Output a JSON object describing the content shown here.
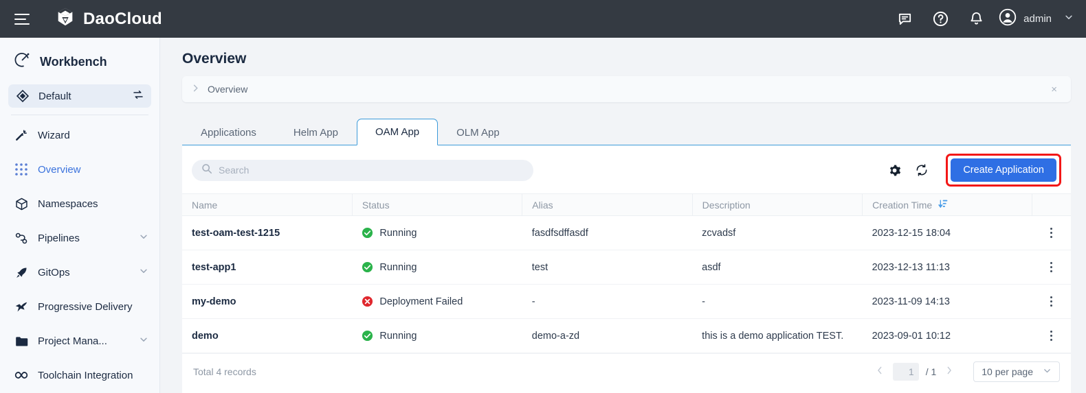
{
  "topbar": {
    "menu_icon": "hamburger-icon",
    "brand": "DaoCloud",
    "icons": [
      "chat-icon",
      "help-icon",
      "bell-icon"
    ],
    "user": "admin"
  },
  "sidebar": {
    "header": "Workbench",
    "workspace": {
      "label": "Default",
      "switch_icon": "switch-icon"
    },
    "items": [
      {
        "label": "Wizard",
        "icon": "wand-icon",
        "expandable": false,
        "active": false
      },
      {
        "label": "Overview",
        "icon": "grid-icon",
        "expandable": false,
        "active": true
      },
      {
        "label": "Namespaces",
        "icon": "cube-icon",
        "expandable": false,
        "active": false
      },
      {
        "label": "Pipelines",
        "icon": "pipeline-icon",
        "expandable": true,
        "active": false
      },
      {
        "label": "GitOps",
        "icon": "rocket-icon",
        "expandable": true,
        "active": false
      },
      {
        "label": "Progressive Delivery",
        "icon": "bird-icon",
        "expandable": false,
        "active": false
      },
      {
        "label": "Project Mana...",
        "icon": "folder-icon",
        "expandable": true,
        "active": false
      },
      {
        "label": "Toolchain Integration",
        "icon": "infinity-icon",
        "expandable": false,
        "active": false
      }
    ]
  },
  "page": {
    "title": "Overview",
    "breadcrumb": "Overview",
    "breadcrumb_close": "×"
  },
  "tabs": [
    {
      "label": "Applications",
      "active": false
    },
    {
      "label": "Helm App",
      "active": false
    },
    {
      "label": "OAM App",
      "active": true
    },
    {
      "label": "OLM App",
      "active": false
    }
  ],
  "toolbar": {
    "search_placeholder": "Search",
    "search_value": "",
    "settings_icon": "gear-icon",
    "refresh_icon": "refresh-icon",
    "create_label": "Create Application",
    "highlight_color": "#f31717",
    "button_color": "#2f6fe4"
  },
  "table": {
    "columns": [
      "Name",
      "Status",
      "Alias",
      "Description",
      "Creation Time"
    ],
    "sort_column": "Creation Time",
    "sort_icon": "sort-descending-icon",
    "rows": [
      {
        "name": "test-oam-test-1215",
        "status": "Running",
        "status_type": "success",
        "alias": "fasdfsdffasdf",
        "description": "zcvadsf",
        "creation_time": "2023-12-15 18:04"
      },
      {
        "name": "test-app1",
        "status": "Running",
        "status_type": "success",
        "alias": "test",
        "description": "asdf",
        "creation_time": "2023-12-13 11:13"
      },
      {
        "name": "my-demo",
        "status": "Deployment Failed",
        "status_type": "error",
        "alias": "-",
        "description": "-",
        "creation_time": "2023-11-09 14:13"
      },
      {
        "name": "demo",
        "status": "Running",
        "status_type": "success",
        "alias": "demo-a-zd",
        "description": "this is a demo application TEST.",
        "creation_time": "2023-09-01 10:12"
      }
    ]
  },
  "footer": {
    "total_text": "Total 4 records",
    "current_page": "1",
    "page_separator": "/ 1",
    "per_page": "10 per page"
  },
  "colors": {
    "success": "#2bb34b",
    "error": "#e0282e",
    "accent": "#3b9ad9",
    "link": "#3b73dd"
  }
}
